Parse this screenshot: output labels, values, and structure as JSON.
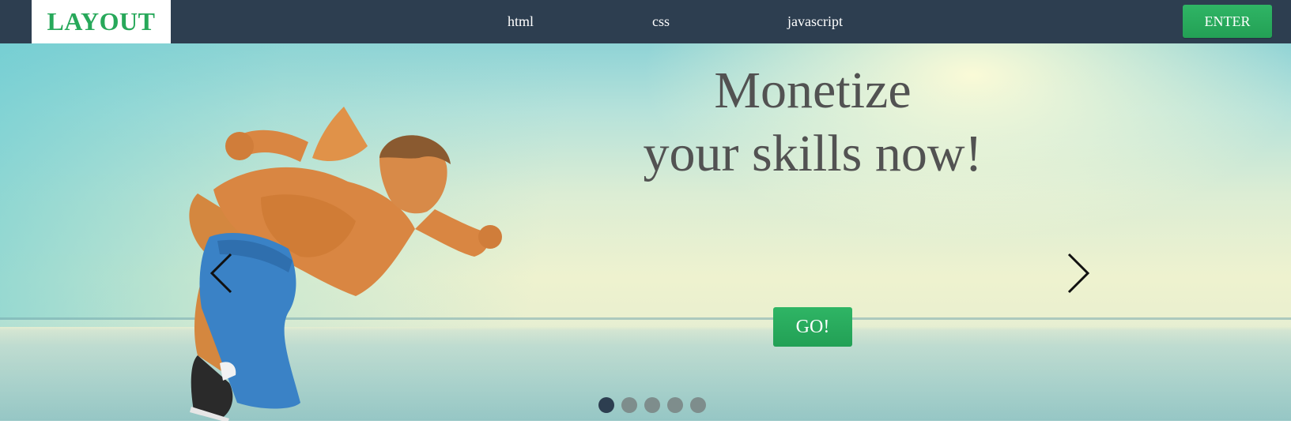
{
  "header": {
    "logo_text": "LAYOUT",
    "nav": [
      {
        "label": "html"
      },
      {
        "label": "css"
      },
      {
        "label": "javascript"
      }
    ],
    "enter_label": "ENTER"
  },
  "hero": {
    "headline_line1": "Monetize",
    "headline_line2": "your skills now!",
    "cta_label": "GO!",
    "slide_count": 5,
    "active_slide": 1,
    "prev_icon": "chevron-left-icon",
    "next_icon": "chevron-right-icon"
  },
  "colors": {
    "nav_bg": "#2d3e50",
    "accent_green": "#27a85a",
    "headline_text": "#525252",
    "dot_active": "#2d3e50",
    "dot_inactive": "#7e8d8c"
  }
}
